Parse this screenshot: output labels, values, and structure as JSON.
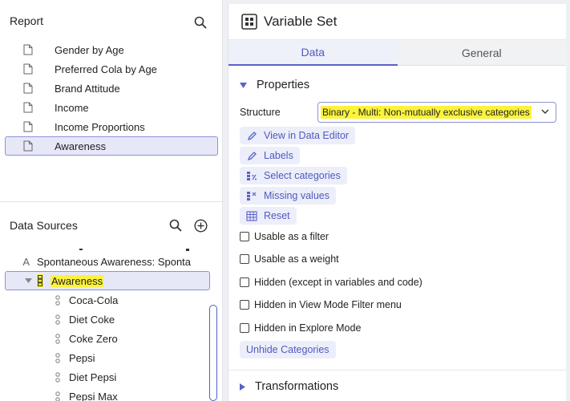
{
  "report": {
    "title": "Report",
    "items": [
      {
        "label": "Gender by Age"
      },
      {
        "label": "Preferred Cola by Age"
      },
      {
        "label": "Brand Attitude"
      },
      {
        "label": "Income"
      },
      {
        "label": "Income Proportions"
      },
      {
        "label": "Awareness",
        "selected": true
      }
    ]
  },
  "data_sources": {
    "title": "Data Sources",
    "spontaneous": "Spontaneous Awareness: Sponta",
    "spontaneous_type": "A",
    "awareness": "Awareness",
    "children": [
      {
        "label": "Coca-Cola"
      },
      {
        "label": "Diet Coke"
      },
      {
        "label": "Coke Zero"
      },
      {
        "label": "Pepsi"
      },
      {
        "label": "Diet Pepsi"
      },
      {
        "label": "Pepsi Max"
      }
    ]
  },
  "panel": {
    "title": "Variable Set",
    "tabs": [
      {
        "label": "Data",
        "active": true
      },
      {
        "label": "General",
        "active": false
      }
    ],
    "properties_label": "Properties",
    "structure_label": "Structure",
    "structure_value": "Binary - Multi: Non-mutually exclusive categories",
    "actions": {
      "view": "View in Data Editor",
      "labels": "Labels",
      "select": "Select categories",
      "missing": "Missing values",
      "reset": "Reset"
    },
    "checkboxes": {
      "filter": "Usable as a filter",
      "weight": "Usable as a weight",
      "hidden": "Hidden (except in variables and code)",
      "hidden_view": "Hidden in View Mode Filter menu",
      "hidden_explore": "Hidden in Explore Mode"
    },
    "unhide": "Unhide Categories",
    "transformations_label": "Transformations"
  },
  "colors": {
    "accent": "#5a62c7",
    "highlight": "#fbf33c",
    "selected_bg": "#e6e8f8"
  }
}
